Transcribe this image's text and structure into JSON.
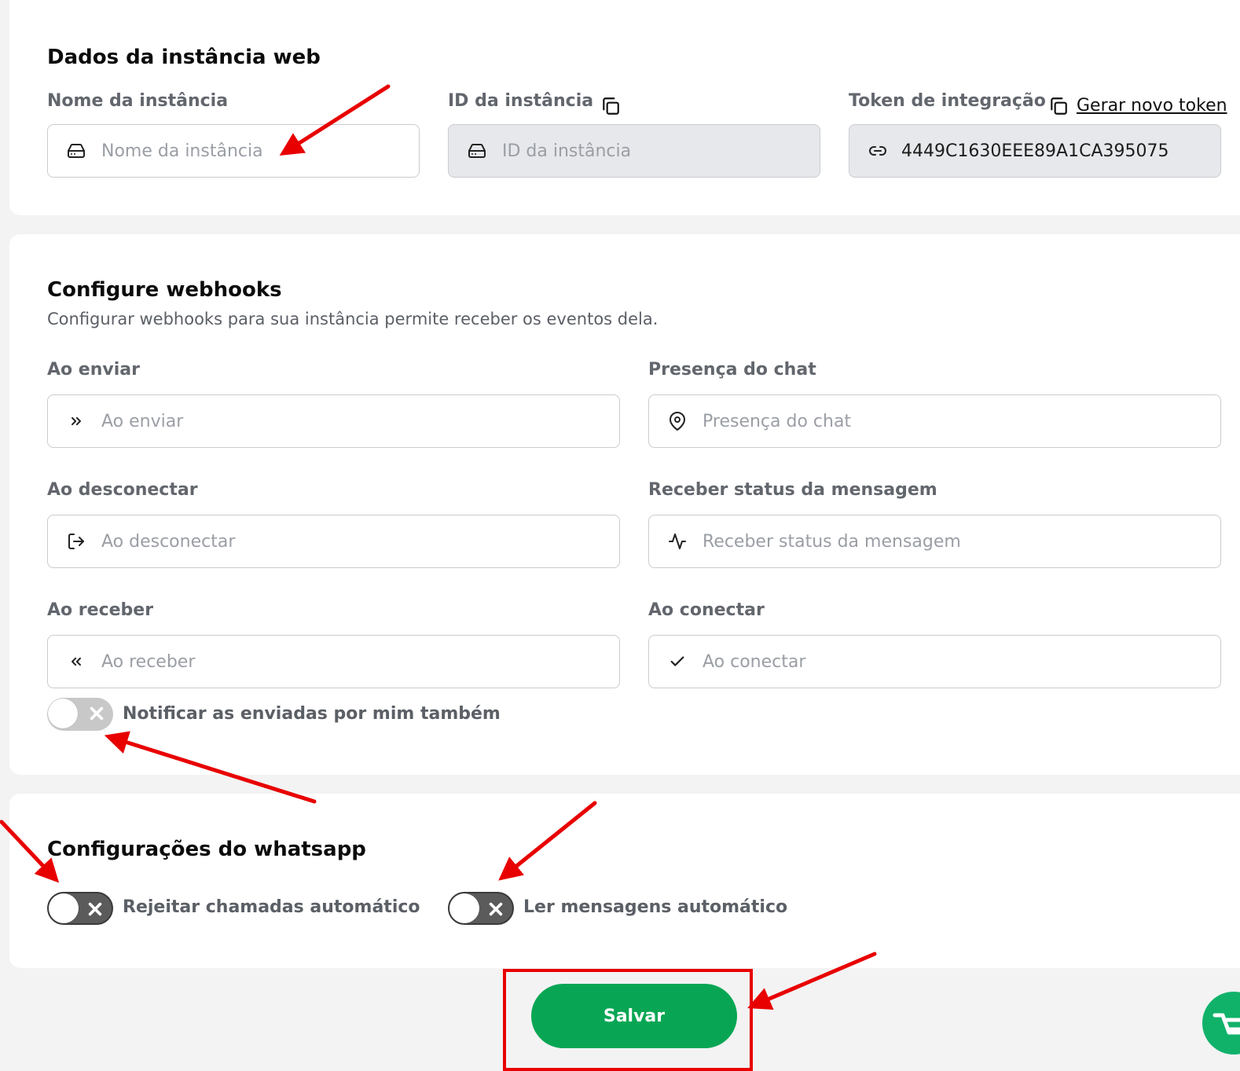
{
  "instance": {
    "title": "Dados da instância web",
    "name_label": "Nome da instância",
    "name_placeholder": "Nome da instância",
    "id_label": "ID da instância",
    "id_placeholder": "ID da instância",
    "token_label": "Token de integração",
    "generate_token_label": "Gerar novo token",
    "token_value": "4449C1630EEE89A1CA395075"
  },
  "webhooks": {
    "title": "Configure webhooks",
    "subtitle": "Configurar webhooks para sua instância permite receber os eventos dela.",
    "on_send": {
      "label": "Ao enviar",
      "placeholder": "Ao enviar",
      "icon": "chevrons-right-icon"
    },
    "chat_presence": {
      "label": "Presença do chat",
      "placeholder": "Presença do chat",
      "icon": "map-pin-icon"
    },
    "on_disconnect": {
      "label": "Ao desconectar",
      "placeholder": "Ao desconectar",
      "icon": "log-out-icon"
    },
    "message_status": {
      "label": "Receber status da mensagem",
      "placeholder": "Receber status da mensagem",
      "icon": "activity-icon"
    },
    "on_receive": {
      "label": "Ao receber",
      "placeholder": "Ao receber",
      "icon": "chevrons-left-icon"
    },
    "on_connect": {
      "label": "Ao conectar",
      "placeholder": "Ao conectar",
      "icon": "check-icon"
    },
    "notify_sent_by_me": {
      "label": "Notificar as enviadas por mim também",
      "enabled": false
    }
  },
  "whatsapp": {
    "title": "Configurações do whatsapp",
    "reject_calls": {
      "label": "Rejeitar chamadas automático",
      "enabled": false
    },
    "read_messages": {
      "label": "Ler mensagens automático",
      "enabled": false
    }
  },
  "actions": {
    "save_label": "Salvar"
  },
  "colors": {
    "primary": "#08a654",
    "annotation": "#e80000"
  }
}
